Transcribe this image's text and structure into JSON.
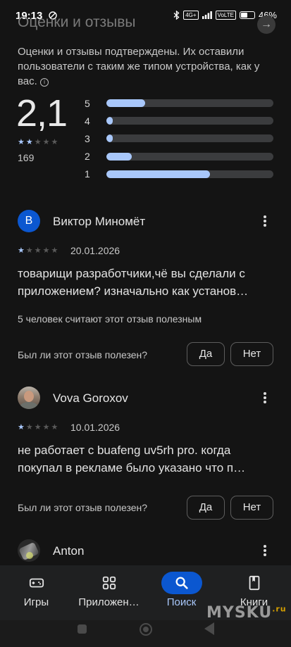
{
  "status_bar": {
    "time": "19:13",
    "network": "4G+",
    "network2": "VoLTE",
    "battery": "46%"
  },
  "header": {
    "title": "Оценки и отзывы",
    "arrow_icon": "arrow-right-icon"
  },
  "summary": {
    "verified_text": "Оценки и отзывы подтверждены. Их оставили пользователи с таким же типом устройства, как у вас.",
    "info_icon": "info-icon",
    "rating": "2,1",
    "stars_filled": 2.1,
    "review_count": "169",
    "distribution": [
      {
        "label": "5",
        "fraction": 0.23
      },
      {
        "label": "4",
        "fraction": 0.04
      },
      {
        "label": "3",
        "fraction": 0.04
      },
      {
        "label": "2",
        "fraction": 0.15
      },
      {
        "label": "1",
        "fraction": 0.62
      }
    ]
  },
  "reviews": [
    {
      "author": "Виктор Миномёт",
      "avatar_letter": "В",
      "avatar_color": "#0b57d0",
      "stars": 1,
      "date": "20.01.2026",
      "text": "товарищи разработчики,чё вы сделали с приложением? изначально как установ…",
      "helpful_count": "5 человек считают этот отзыв полезным",
      "question": "Был ли этот отзыв полезен?",
      "yes": "Да",
      "no": "Нет"
    },
    {
      "author": "Vova Goroxov",
      "stars": 1,
      "date": "10.01.2026",
      "text": "не работает с buafeng uv5rh pro. когда покупал в рекламе было указано что п…",
      "question": "Был ли этот отзыв полезен?",
      "yes": "Да",
      "no": "Нет"
    },
    {
      "author": "Anton"
    }
  ],
  "bottom_nav": [
    {
      "label": "Игры",
      "icon": "gamepad-icon",
      "active": false
    },
    {
      "label": "Приложен…",
      "icon": "apps-grid-icon",
      "active": false
    },
    {
      "label": "Поиск",
      "icon": "search-icon",
      "active": true
    },
    {
      "label": "Книги",
      "icon": "book-icon",
      "active": false
    }
  ],
  "watermark": {
    "text": "MYSKU",
    "suffix": ".ru"
  },
  "colors": {
    "accent": "#a8c7fa",
    "active_pill": "#0b57d0",
    "background": "#141414"
  }
}
